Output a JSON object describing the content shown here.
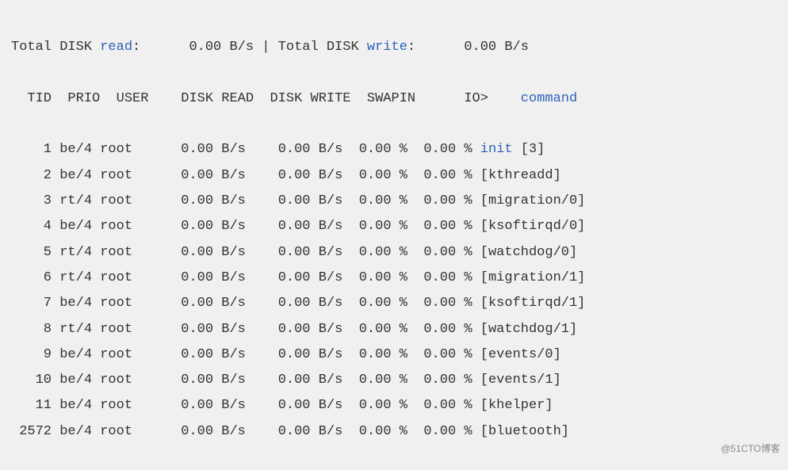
{
  "summary": {
    "total_read_label": "Total DISK ",
    "read_hl": "read",
    "read_colon": ":",
    "total_read_value": "0.00 B/s",
    "separator": "|",
    "total_write_label": "Total DISK ",
    "write_hl": "write",
    "write_colon": ":",
    "total_write_value": "0.00 B/s"
  },
  "headers": {
    "tid": "TID",
    "prio": "PRIO",
    "user": "USER",
    "disk_read": "DISK READ",
    "disk_write": "DISK WRITE",
    "swapin": "SWAPIN",
    "io": "IO>",
    "command": "command"
  },
  "rows": [
    {
      "tid": "1",
      "prio": "be/4",
      "user": "root",
      "disk_read": "0.00 B/s",
      "disk_write": "0.00 B/s",
      "swapin": "0.00 %",
      "io": "0.00 %",
      "cmd_hl": "init",
      "cmd_rest": " [3]"
    },
    {
      "tid": "2",
      "prio": "be/4",
      "user": "root",
      "disk_read": "0.00 B/s",
      "disk_write": "0.00 B/s",
      "swapin": "0.00 %",
      "io": "0.00 %",
      "cmd_hl": "",
      "cmd_rest": "[kthreadd]"
    },
    {
      "tid": "3",
      "prio": "rt/4",
      "user": "root",
      "disk_read": "0.00 B/s",
      "disk_write": "0.00 B/s",
      "swapin": "0.00 %",
      "io": "0.00 %",
      "cmd_hl": "",
      "cmd_rest": "[migration/0]"
    },
    {
      "tid": "4",
      "prio": "be/4",
      "user": "root",
      "disk_read": "0.00 B/s",
      "disk_write": "0.00 B/s",
      "swapin": "0.00 %",
      "io": "0.00 %",
      "cmd_hl": "",
      "cmd_rest": "[ksoftirqd/0]"
    },
    {
      "tid": "5",
      "prio": "rt/4",
      "user": "root",
      "disk_read": "0.00 B/s",
      "disk_write": "0.00 B/s",
      "swapin": "0.00 %",
      "io": "0.00 %",
      "cmd_hl": "",
      "cmd_rest": "[watchdog/0]"
    },
    {
      "tid": "6",
      "prio": "rt/4",
      "user": "root",
      "disk_read": "0.00 B/s",
      "disk_write": "0.00 B/s",
      "swapin": "0.00 %",
      "io": "0.00 %",
      "cmd_hl": "",
      "cmd_rest": "[migration/1]"
    },
    {
      "tid": "7",
      "prio": "be/4",
      "user": "root",
      "disk_read": "0.00 B/s",
      "disk_write": "0.00 B/s",
      "swapin": "0.00 %",
      "io": "0.00 %",
      "cmd_hl": "",
      "cmd_rest": "[ksoftirqd/1]"
    },
    {
      "tid": "8",
      "prio": "rt/4",
      "user": "root",
      "disk_read": "0.00 B/s",
      "disk_write": "0.00 B/s",
      "swapin": "0.00 %",
      "io": "0.00 %",
      "cmd_hl": "",
      "cmd_rest": "[watchdog/1]"
    },
    {
      "tid": "9",
      "prio": "be/4",
      "user": "root",
      "disk_read": "0.00 B/s",
      "disk_write": "0.00 B/s",
      "swapin": "0.00 %",
      "io": "0.00 %",
      "cmd_hl": "",
      "cmd_rest": "[events/0]"
    },
    {
      "tid": "10",
      "prio": "be/4",
      "user": "root",
      "disk_read": "0.00 B/s",
      "disk_write": "0.00 B/s",
      "swapin": "0.00 %",
      "io": "0.00 %",
      "cmd_hl": "",
      "cmd_rest": "[events/1]"
    },
    {
      "tid": "11",
      "prio": "be/4",
      "user": "root",
      "disk_read": "0.00 B/s",
      "disk_write": "0.00 B/s",
      "swapin": "0.00 %",
      "io": "0.00 %",
      "cmd_hl": "",
      "cmd_rest": "[khelper]"
    },
    {
      "tid": "2572",
      "prio": "be/4",
      "user": "root",
      "disk_read": "0.00 B/s",
      "disk_write": "0.00 B/s",
      "swapin": "0.00 %",
      "io": "0.00 %",
      "cmd_hl": "",
      "cmd_rest": "[bluetooth]"
    }
  ],
  "watermark": "@51CTO博客"
}
